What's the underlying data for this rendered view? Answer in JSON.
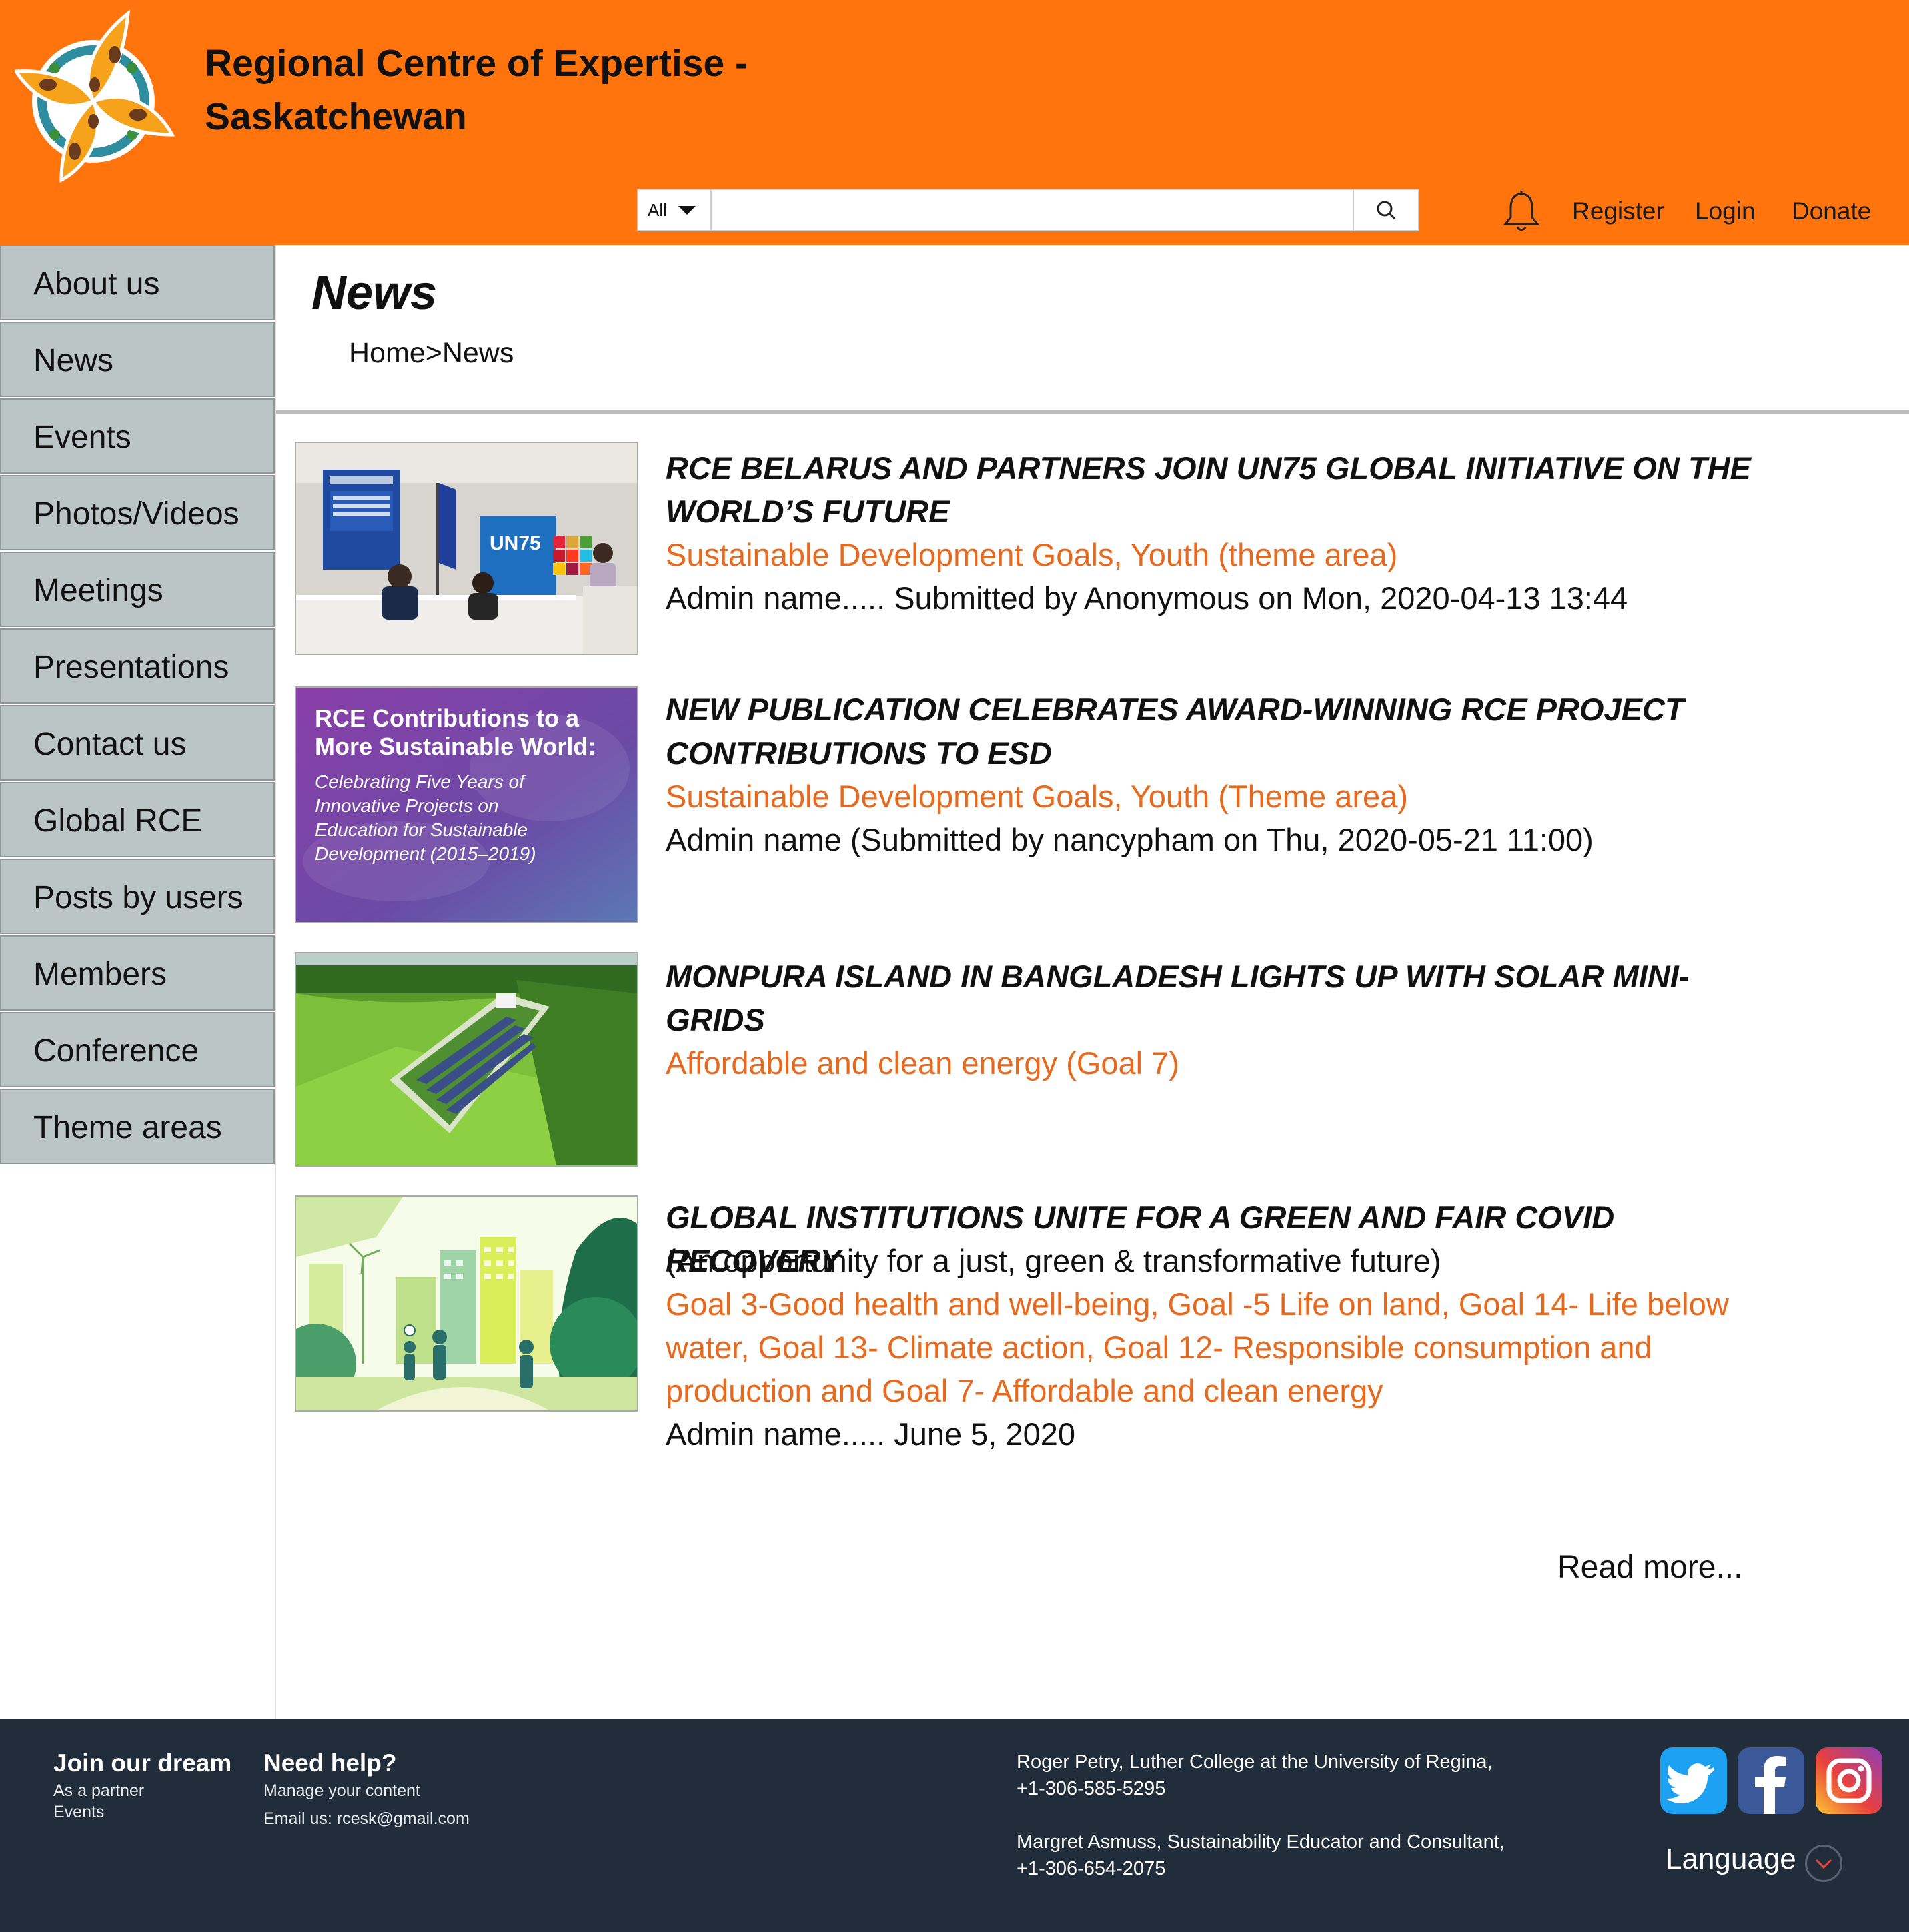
{
  "header": {
    "title_line1": "Regional Centre of Expertise -",
    "title_line2": "Saskatchewan",
    "search_scope": "All",
    "search_placeholder": "",
    "links": {
      "register": "Register",
      "login": "Login",
      "donate": "Donate"
    },
    "brand_color": "#ff740c"
  },
  "sidebar": {
    "items": [
      {
        "label": "About us"
      },
      {
        "label": "News"
      },
      {
        "label": "Events"
      },
      {
        "label": "Photos/Videos"
      },
      {
        "label": "Meetings"
      },
      {
        "label": "Presentations"
      },
      {
        "label": "Contact us"
      },
      {
        "label": "Global RCE"
      },
      {
        "label": "Posts by users"
      },
      {
        "label": "Members"
      },
      {
        "label": "Conference"
      },
      {
        "label": "Theme areas"
      }
    ]
  },
  "main": {
    "page_title": "News",
    "breadcrumb": "Home>News",
    "articles": [
      {
        "title": "RCE BELARUS AND PARTNERS JOIN UN75 GLOBAL INITIATIVE ON THE WORLD’S FUTURE",
        "tags": "Sustainable Development Goals, Youth (theme area)",
        "meta": "Admin name..... Submitted by Anonymous  on Mon, 2020-04-13 13:44",
        "thumb_text": [
          "UN75"
        ]
      },
      {
        "title": "NEW PUBLICATION CELEBRATES AWARD-WINNING RCE PROJECT CONTRIBUTIONS TO ESD",
        "tags": "Sustainable Development Goals, Youth (Theme area)",
        "meta": "Admin name (Submitted by nancypham on Thu, 2020-05-21 11:00)",
        "thumb_text": [
          "RCE Contributions to a",
          "More Sustainable World:",
          "Celebrating Five Years of",
          "Innovative Projects on",
          "Education for Sustainable",
          "Development (2015–2019)"
        ]
      },
      {
        "title": "MONPURA ISLAND IN BANGLADESH LIGHTS UP WITH SOLAR MINI-GRIDS",
        "tags": "Affordable and clean energy (Goal 7)"
      },
      {
        "title": "GLOBAL INSTITUTIONS UNITE FOR A GREEN AND FAIR COVID RECOVERY",
        "subtitle": "(An opportunity for a just, green & transformative future)",
        "tags": "Goal 3-Good health and well-being, Goal -5 Life on land, Goal 14- Life below water, Goal 13- Climate action, Goal 12- Responsible consumption and production and Goal 7- Affordable and clean energy",
        "meta": "Admin name..... June 5, 2020"
      }
    ],
    "read_more": "Read more...",
    "tag_color": "#e8681c"
  },
  "footer": {
    "join_title": "Join our dream",
    "join_links": [
      "As a partner",
      "Events"
    ],
    "help_title": "Need help?",
    "help_links": [
      "Manage your content",
      "Email us: rcesk@gmail.com"
    ],
    "contacts": [
      {
        "line1": "Roger Petry, Luther College at the University of Regina,",
        "line2": "+1-306-585-5295"
      },
      {
        "line1": "Margret Asmuss, Sustainability Educator and Consultant,",
        "line2": "+1-306-654-2075"
      }
    ],
    "social": [
      "twitter-icon",
      "facebook-icon",
      "instagram-icon"
    ],
    "language_label": "Language",
    "background": "#222d3c"
  }
}
